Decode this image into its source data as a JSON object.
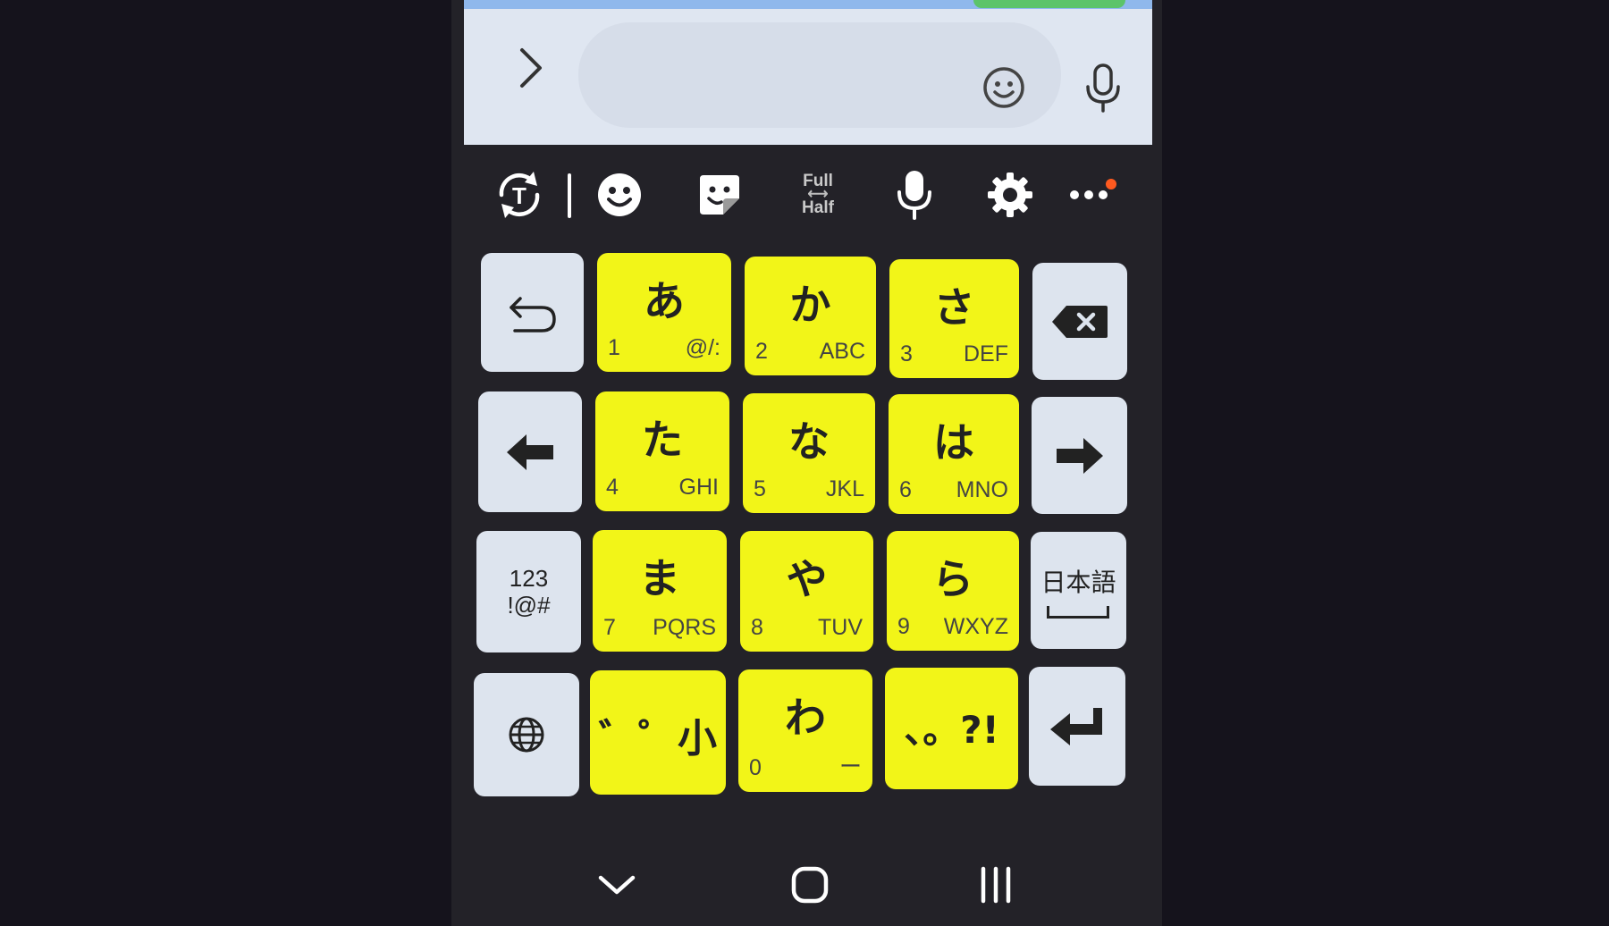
{
  "input_area": {
    "message_placeholder": "",
    "icons": [
      "chevron-right-icon",
      "smiley-icon",
      "microphone-icon"
    ]
  },
  "toolbar": {
    "full_label": "Full",
    "half_label": "Half",
    "items": [
      "text-mode-toggle-icon",
      "emoji-icon",
      "sticker-icon",
      "full-half-width-toggle",
      "voice-input-icon",
      "settings-gear-icon",
      "more-options-icon"
    ],
    "notification_dot_color": "#ff5a1f"
  },
  "keyboard": {
    "kana_key_color": "#f2f518",
    "function_key_color": "#dde4ee",
    "rows": [
      {
        "left": "undo-icon",
        "keys": [
          {
            "kana": "あ",
            "num": "1",
            "sub": "@/:"
          },
          {
            "kana": "か",
            "num": "2",
            "sub": "ABC"
          },
          {
            "kana": "さ",
            "num": "3",
            "sub": "DEF"
          }
        ],
        "right": "backspace-icon"
      },
      {
        "left": "arrow-left-icon",
        "keys": [
          {
            "kana": "た",
            "num": "4",
            "sub": "GHI"
          },
          {
            "kana": "な",
            "num": "5",
            "sub": "JKL"
          },
          {
            "kana": "は",
            "num": "6",
            "sub": "MNO"
          }
        ],
        "right": "arrow-right-icon"
      },
      {
        "left_label_1": "123",
        "left_label_2": "!@#",
        "keys": [
          {
            "kana": "ま",
            "num": "7",
            "sub": "PQRS"
          },
          {
            "kana": "や",
            "num": "8",
            "sub": "TUV"
          },
          {
            "kana": "ら",
            "num": "9",
            "sub": "WXYZ"
          }
        ],
        "right_label": "日本語"
      },
      {
        "left": "globe-icon",
        "dakuten_label": "゛゜小",
        "wa_key": {
          "kana": "わ",
          "num": "0",
          "sub": "ー"
        },
        "punct_label": "、。?!",
        "right": "enter-icon"
      }
    ]
  },
  "navbar": {
    "items": [
      "chevron-down-icon",
      "home-icon",
      "recents-icon"
    ]
  }
}
